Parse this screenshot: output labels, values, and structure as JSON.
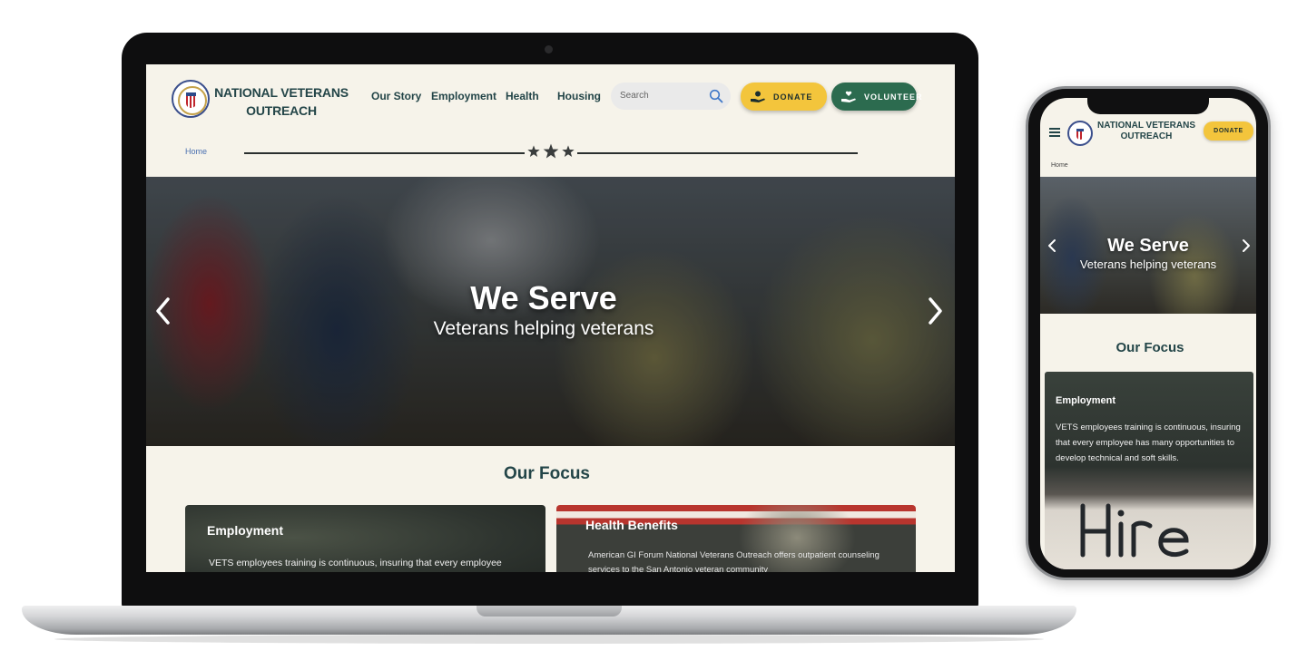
{
  "desktop": {
    "brand": "NATIONAL VETERANS OUTREACH",
    "nav": {
      "our_story": "Our Story",
      "employment": "Employment",
      "health": "Health",
      "housing": "Housing"
    },
    "search": {
      "placeholder": "Search"
    },
    "buttons": {
      "donate": "DONATE",
      "volunteer": "VOLUNTEER"
    },
    "breadcrumb": "Home",
    "hero": {
      "title": "We Serve",
      "subtitle": "Veterans helping veterans"
    },
    "focus": {
      "title": "Our Focus",
      "cards": [
        {
          "title": "Employment",
          "text": "VETS employees training is continuous, insuring that every employee"
        },
        {
          "title": "Health Benefits",
          "text": "American GI Forum National Veterans Outreach offers outpatient counseling services to the San Antonio veteran community"
        }
      ]
    }
  },
  "mobile": {
    "brand": "NATIONAL VETERANS OUTREACH",
    "donate": "DONATE",
    "breadcrumb": "Home",
    "hero": {
      "title": "We Serve",
      "subtitle": "Veterans helping veterans"
    },
    "focus": {
      "title": "Our Focus",
      "card": {
        "title": "Employment",
        "text": "VETS employees training is continuous, insuring that every employee has many opportunities to develop technical and soft skills.",
        "photo_sign": "Hire Me!"
      }
    }
  },
  "colors": {
    "page_bg": "#f6f3ea",
    "primary_text": "#234548",
    "donate": "#f3c53c",
    "volunteer": "#2c6b4f",
    "breadcrumb_link": "#4a70b0"
  },
  "icons": [
    "seal-logo",
    "search-icon",
    "donate-hand-icon",
    "volunteer-hand-icon",
    "star-icon",
    "chevron-left-icon",
    "chevron-right-icon",
    "hamburger-menu-icon"
  ]
}
